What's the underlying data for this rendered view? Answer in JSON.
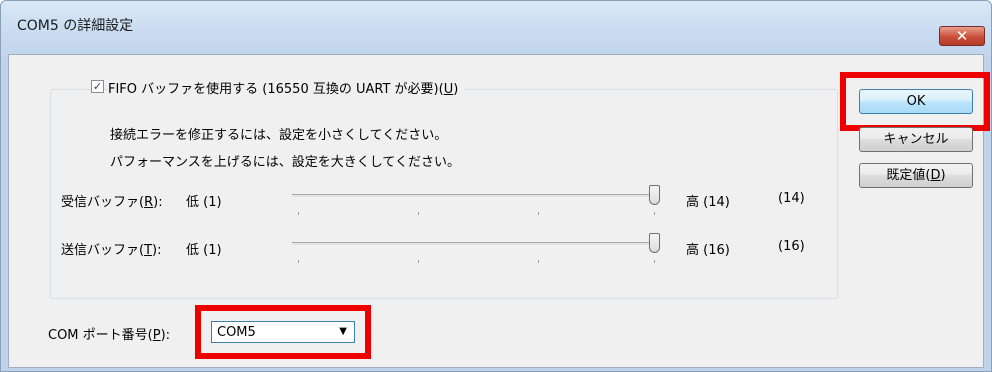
{
  "window": {
    "title": "COM5 の詳細設定",
    "close_glyph": "✕"
  },
  "fifo": {
    "checked": true,
    "check_glyph": "✓",
    "label_text": "FIFO バッファを使用する (16550 互換の UART が必要)(",
    "label_key": "U",
    "label_end": ")"
  },
  "hints": {
    "line1": "接続エラーを修正するには、設定を小さくしてください。",
    "line2": "パフォーマンスを上げるには、設定を大きくしてください。"
  },
  "receive": {
    "label_text": "受信バッファ(",
    "label_key": "R",
    "label_end": "):",
    "low": "低 (1)",
    "high": "高 (14)",
    "value": "(14)",
    "level": 1.0
  },
  "transmit": {
    "label_text": "送信バッファ(",
    "label_key": "T",
    "label_end": "):",
    "low": "低 (1)",
    "high": "高 (16)",
    "value": "(16)",
    "level": 1.0
  },
  "buttons": {
    "ok": "OK",
    "cancel": "キャンセル",
    "default_text": "既定値(",
    "default_key": "D",
    "default_end": ")"
  },
  "com_port": {
    "label_text": "COM ポート番号(",
    "label_key": "P",
    "label_end": "):",
    "selected": "COM5",
    "arrow_glyph": "▼"
  },
  "colors": {
    "highlight": "#ee0000",
    "window_frame": "#bed2ea",
    "client_bg": "#f0f0f0"
  }
}
